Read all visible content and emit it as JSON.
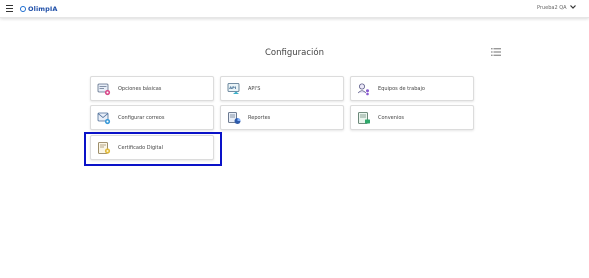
{
  "header": {
    "brand": "OlimpIA",
    "user_name": "Prueba2 QA"
  },
  "page": {
    "title": "Configuración"
  },
  "cards": [
    {
      "label": "Opciones básicas",
      "icon": "basic-options-icon"
    },
    {
      "label": "API'S",
      "icon": "api-icon"
    },
    {
      "label": "Equipos de trabajo",
      "icon": "work-teams-icon"
    },
    {
      "label": "Configurar correos",
      "icon": "email-config-icon"
    },
    {
      "label": "Reportes",
      "icon": "reports-icon"
    },
    {
      "label": "Convenios",
      "icon": "agreements-icon"
    },
    {
      "label": "Certificado Digital",
      "icon": "digital-certificate-icon"
    }
  ],
  "colors": {
    "brand": "#1f4fa8",
    "highlight": "#0a12c8"
  }
}
